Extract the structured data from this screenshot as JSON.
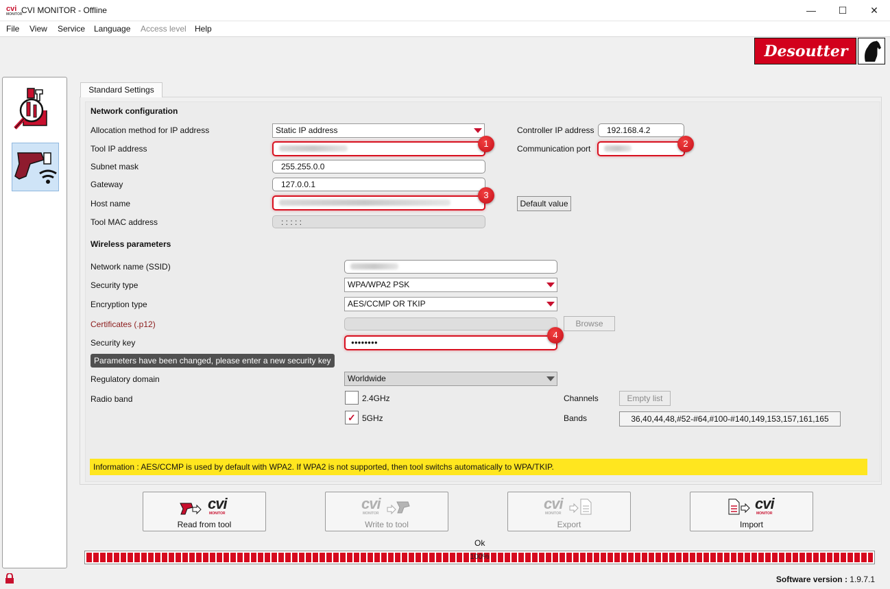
{
  "window": {
    "title": "CVI MONITOR - Offline",
    "logo_text": "cvi",
    "logo_sub": "MONITOR",
    "min": "—",
    "max": "☐",
    "close": "✕"
  },
  "menu": [
    "File",
    "View",
    "Service",
    "Language",
    "Access level",
    "Help"
  ],
  "brand": "Desoutter",
  "tab": "Standard Settings",
  "network": {
    "title": "Network configuration",
    "allocation_label": "Allocation method for IP address",
    "allocation_value": "Static IP address",
    "tool_ip_label": "Tool IP address",
    "subnet_label": "Subnet mask",
    "subnet_value": "255.255.0.0",
    "gateway_label": "Gateway",
    "gateway_value": "127.0.0.1",
    "host_label": "Host name",
    "mac_label": "Tool MAC address",
    "mac_value": ": : : : :",
    "controller_ip_label": "Controller IP address",
    "controller_ip_value": "192.168.4.2",
    "comm_port_label": "Communication port",
    "default_value_button": "Default value"
  },
  "wireless": {
    "title": "Wireless parameters",
    "ssid_label": "Network name (SSID)",
    "security_type_label": "Security  type",
    "security_type_value": "WPA/WPA2 PSK",
    "encryption_label": "Encryption type",
    "encryption_value": "AES/CCMP OR TKIP",
    "cert_label": "Certificates (.p12)",
    "browse_button": "Browse",
    "key_label": "Security key",
    "key_value": "●●●●●●●●",
    "warning": "Parameters have been changed, please enter a new security key",
    "regulatory_label": "Regulatory domain",
    "regulatory_value": "Worldwide",
    "radio_label": "Radio band",
    "band_24": "2.4GHz",
    "band_5": "5GHz",
    "band_5_checked": true,
    "band_24_checked": false,
    "channels_label": "Channels",
    "empty_list_button": "Empty list",
    "bands_label": "Bands",
    "bands_value": "36,40,44,48,#52-#64,#100-#140,149,153,157,161,165"
  },
  "badges": [
    "1",
    "2",
    "3",
    "4"
  ],
  "info": "Information :  AES/CCMP is used by default with WPA2. If WPA2 is not supported, then tool switchs automatically  to WPA/TKIP.",
  "actions": [
    {
      "label": "Read from tool",
      "enabled": true
    },
    {
      "label": "Write to tool",
      "enabled": false
    },
    {
      "label": "Export",
      "enabled": false
    },
    {
      "label": "Import",
      "enabled": true
    }
  ],
  "cvi_word": "cvi",
  "cvi_sub": "MONITOR",
  "status": "Ok",
  "progress": {
    "percent": 100,
    "text": "100%"
  },
  "version": {
    "label": "Software version :",
    "value": "1.9.7.1"
  },
  "colors": {
    "accent": "#d2001c",
    "highlight": "#ffe61f"
  }
}
